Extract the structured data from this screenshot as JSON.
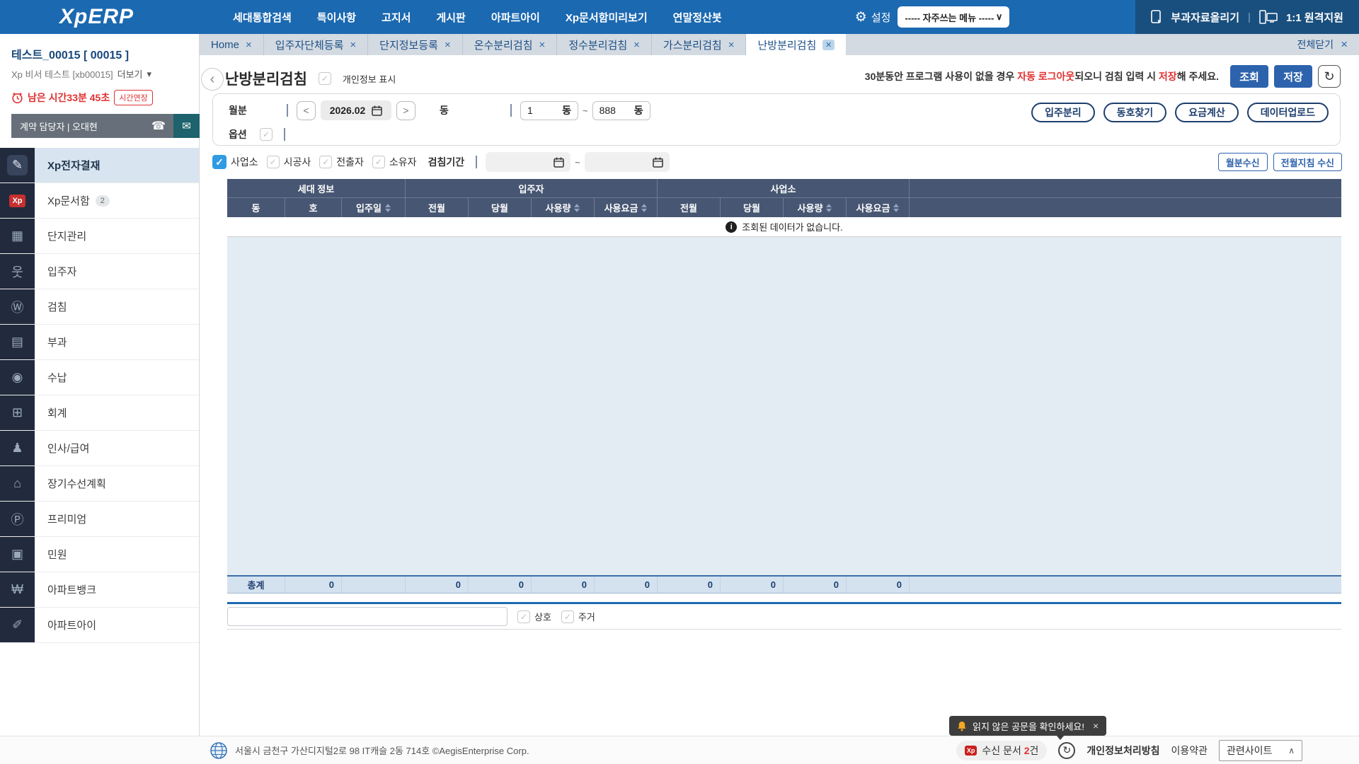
{
  "topbar": {
    "logo": "XpERP",
    "menu": [
      "세대통합검색",
      "특이사항",
      "고지서",
      "게시판",
      "아파트아이",
      "Xp문서함미리보기",
      "연말정산봇"
    ],
    "settings_label": "설정",
    "favorites_dropdown": "----- 자주쓰는 메뉴 -----",
    "upload_button": "부과자료올리기",
    "remote_button": "1:1 원격지원"
  },
  "tabs": {
    "items": [
      {
        "label": "Home"
      },
      {
        "label": "입주자단체등록"
      },
      {
        "label": "단지정보등록"
      },
      {
        "label": "온수분리검침"
      },
      {
        "label": "정수분리검침"
      },
      {
        "label": "가스분리검침"
      },
      {
        "label": "난방분리검침"
      }
    ],
    "close_all": "전체닫기"
  },
  "sidebar": {
    "org_title": "테스트_00015 [ 00015 ]",
    "org_sub": "Xp 비서 테스트 [xb00015]",
    "more_label": "더보기",
    "time_left": "남은 시간33분 45초",
    "extend_button": "시간연장",
    "contact_label": "계약 담당자 | 오대현",
    "menu": [
      {
        "label": "Xp전자결재",
        "glyph": "✎"
      },
      {
        "label": "Xp문서함",
        "glyph": "Xp",
        "badge": "2"
      },
      {
        "label": "단지관리",
        "glyph": "▦"
      },
      {
        "label": "입주자",
        "glyph": "웃"
      },
      {
        "label": "검침",
        "glyph": "Ⓦ"
      },
      {
        "label": "부과",
        "glyph": "▤"
      },
      {
        "label": "수납",
        "glyph": "◉"
      },
      {
        "label": "회계",
        "glyph": "⊞"
      },
      {
        "label": "인사/급여",
        "glyph": "♟"
      },
      {
        "label": "장기수선계획",
        "glyph": "⌂"
      },
      {
        "label": "프리미엄",
        "glyph": "Ⓟ"
      },
      {
        "label": "민원",
        "glyph": "▣"
      },
      {
        "label": "아파트뱅크",
        "glyph": "₩"
      },
      {
        "label": "아파트아이",
        "glyph": "✐"
      }
    ]
  },
  "page": {
    "title": "난방분리검침",
    "privacy_checkbox": "개인정보 표시",
    "notice": {
      "p1": "30분동안 프로그램 사용이 없을 경우 ",
      "r1": "자동 로그아웃",
      "p2": "되오니 검침 입력 시 ",
      "r2": "저장",
      "p3": "해 주세요."
    },
    "search_button": "조회",
    "save_button": "저장"
  },
  "form": {
    "month_label": "월분",
    "month_value": "2026.02",
    "dong_label": "동",
    "dong_from": "1",
    "dong_to": "888",
    "dong_unit": "동",
    "tilde": "~",
    "option_label": "옵션",
    "action_buttons": [
      "입주분리",
      "동호찾기",
      "요금계산",
      "데이터업로드"
    ]
  },
  "filters": {
    "checkboxes": [
      {
        "label": "사업소",
        "checked": true
      },
      {
        "label": "시공사",
        "checked": false
      },
      {
        "label": "전출자",
        "checked": false
      },
      {
        "label": "소유자",
        "checked": false
      }
    ],
    "period_label": "검침기간",
    "tilde": "~",
    "receive_buttons": [
      "월분수신",
      "전월지침 수신"
    ]
  },
  "table": {
    "groups": [
      "세대 정보",
      "입주자",
      "사업소"
    ],
    "columns": [
      "동",
      "호",
      "입주일",
      "전월",
      "당월",
      "사용량",
      "사용요금",
      "전월",
      "당월",
      "사용량",
      "사용요금"
    ],
    "empty_message": "조회된 데이터가 없습니다.",
    "total_label": "총계",
    "totals": [
      "0",
      "",
      "0",
      "0",
      "0",
      "0",
      "0",
      "0",
      "0",
      "0"
    ]
  },
  "bottom": {
    "checkbox1": "상호",
    "checkbox2": "주거"
  },
  "footer": {
    "address": "서울시 금천구 가산디지털2로 98 IT캐슬 2동 714호 ©AegisEnterprise Corp.",
    "docs_pre": "수신 문서 ",
    "docs_count": "2",
    "docs_post": "건",
    "privacy_policy": "개인정보처리방침",
    "terms": "이용약관",
    "related_sites": "관련사이트"
  },
  "toast": {
    "message": "읽지 않은 공문을 확인하세요!"
  },
  "icons": {
    "gear": "⚙",
    "dd_caret": "∨",
    "up_caret": "∧",
    "more_caret": "▾",
    "close": "×",
    "chevron_left": "‹",
    "nav_prev": "<",
    "nav_next": ">",
    "refresh": "↻",
    "check": "✓",
    "phone": "☎",
    "mail": "✉",
    "info": "i",
    "dark_sep": "|"
  },
  "colors": {
    "accent_blue": "#1b69b1",
    "header_navy": "#475672",
    "alert_red": "#e03131"
  }
}
